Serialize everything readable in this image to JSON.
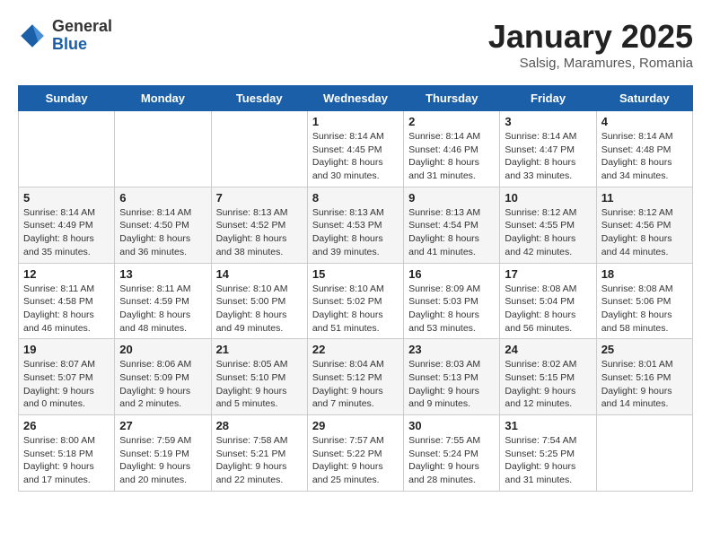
{
  "logo": {
    "general": "General",
    "blue": "Blue"
  },
  "header": {
    "month": "January 2025",
    "location": "Salsig, Maramures, Romania"
  },
  "weekdays": [
    "Sunday",
    "Monday",
    "Tuesday",
    "Wednesday",
    "Thursday",
    "Friday",
    "Saturday"
  ],
  "weeks": [
    [
      {
        "day": "",
        "info": ""
      },
      {
        "day": "",
        "info": ""
      },
      {
        "day": "",
        "info": ""
      },
      {
        "day": "1",
        "info": "Sunrise: 8:14 AM\nSunset: 4:45 PM\nDaylight: 8 hours\nand 30 minutes."
      },
      {
        "day": "2",
        "info": "Sunrise: 8:14 AM\nSunset: 4:46 PM\nDaylight: 8 hours\nand 31 minutes."
      },
      {
        "day": "3",
        "info": "Sunrise: 8:14 AM\nSunset: 4:47 PM\nDaylight: 8 hours\nand 33 minutes."
      },
      {
        "day": "4",
        "info": "Sunrise: 8:14 AM\nSunset: 4:48 PM\nDaylight: 8 hours\nand 34 minutes."
      }
    ],
    [
      {
        "day": "5",
        "info": "Sunrise: 8:14 AM\nSunset: 4:49 PM\nDaylight: 8 hours\nand 35 minutes."
      },
      {
        "day": "6",
        "info": "Sunrise: 8:14 AM\nSunset: 4:50 PM\nDaylight: 8 hours\nand 36 minutes."
      },
      {
        "day": "7",
        "info": "Sunrise: 8:13 AM\nSunset: 4:52 PM\nDaylight: 8 hours\nand 38 minutes."
      },
      {
        "day": "8",
        "info": "Sunrise: 8:13 AM\nSunset: 4:53 PM\nDaylight: 8 hours\nand 39 minutes."
      },
      {
        "day": "9",
        "info": "Sunrise: 8:13 AM\nSunset: 4:54 PM\nDaylight: 8 hours\nand 41 minutes."
      },
      {
        "day": "10",
        "info": "Sunrise: 8:12 AM\nSunset: 4:55 PM\nDaylight: 8 hours\nand 42 minutes."
      },
      {
        "day": "11",
        "info": "Sunrise: 8:12 AM\nSunset: 4:56 PM\nDaylight: 8 hours\nand 44 minutes."
      }
    ],
    [
      {
        "day": "12",
        "info": "Sunrise: 8:11 AM\nSunset: 4:58 PM\nDaylight: 8 hours\nand 46 minutes."
      },
      {
        "day": "13",
        "info": "Sunrise: 8:11 AM\nSunset: 4:59 PM\nDaylight: 8 hours\nand 48 minutes."
      },
      {
        "day": "14",
        "info": "Sunrise: 8:10 AM\nSunset: 5:00 PM\nDaylight: 8 hours\nand 49 minutes."
      },
      {
        "day": "15",
        "info": "Sunrise: 8:10 AM\nSunset: 5:02 PM\nDaylight: 8 hours\nand 51 minutes."
      },
      {
        "day": "16",
        "info": "Sunrise: 8:09 AM\nSunset: 5:03 PM\nDaylight: 8 hours\nand 53 minutes."
      },
      {
        "day": "17",
        "info": "Sunrise: 8:08 AM\nSunset: 5:04 PM\nDaylight: 8 hours\nand 56 minutes."
      },
      {
        "day": "18",
        "info": "Sunrise: 8:08 AM\nSunset: 5:06 PM\nDaylight: 8 hours\nand 58 minutes."
      }
    ],
    [
      {
        "day": "19",
        "info": "Sunrise: 8:07 AM\nSunset: 5:07 PM\nDaylight: 9 hours\nand 0 minutes."
      },
      {
        "day": "20",
        "info": "Sunrise: 8:06 AM\nSunset: 5:09 PM\nDaylight: 9 hours\nand 2 minutes."
      },
      {
        "day": "21",
        "info": "Sunrise: 8:05 AM\nSunset: 5:10 PM\nDaylight: 9 hours\nand 5 minutes."
      },
      {
        "day": "22",
        "info": "Sunrise: 8:04 AM\nSunset: 5:12 PM\nDaylight: 9 hours\nand 7 minutes."
      },
      {
        "day": "23",
        "info": "Sunrise: 8:03 AM\nSunset: 5:13 PM\nDaylight: 9 hours\nand 9 minutes."
      },
      {
        "day": "24",
        "info": "Sunrise: 8:02 AM\nSunset: 5:15 PM\nDaylight: 9 hours\nand 12 minutes."
      },
      {
        "day": "25",
        "info": "Sunrise: 8:01 AM\nSunset: 5:16 PM\nDaylight: 9 hours\nand 14 minutes."
      }
    ],
    [
      {
        "day": "26",
        "info": "Sunrise: 8:00 AM\nSunset: 5:18 PM\nDaylight: 9 hours\nand 17 minutes."
      },
      {
        "day": "27",
        "info": "Sunrise: 7:59 AM\nSunset: 5:19 PM\nDaylight: 9 hours\nand 20 minutes."
      },
      {
        "day": "28",
        "info": "Sunrise: 7:58 AM\nSunset: 5:21 PM\nDaylight: 9 hours\nand 22 minutes."
      },
      {
        "day": "29",
        "info": "Sunrise: 7:57 AM\nSunset: 5:22 PM\nDaylight: 9 hours\nand 25 minutes."
      },
      {
        "day": "30",
        "info": "Sunrise: 7:55 AM\nSunset: 5:24 PM\nDaylight: 9 hours\nand 28 minutes."
      },
      {
        "day": "31",
        "info": "Sunrise: 7:54 AM\nSunset: 5:25 PM\nDaylight: 9 hours\nand 31 minutes."
      },
      {
        "day": "",
        "info": ""
      }
    ]
  ]
}
